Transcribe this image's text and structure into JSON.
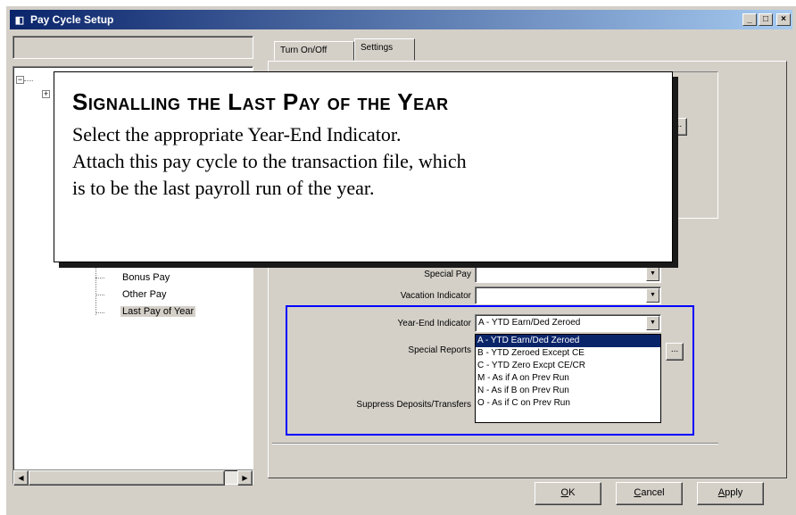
{
  "window": {
    "title": "Pay Cycle Setup",
    "controls": {
      "minimize": "_",
      "maximize": "□",
      "close": "×"
    }
  },
  "tabs": [
    {
      "label": "Turn On/Off"
    },
    {
      "label": "Settings"
    }
  ],
  "tree": {
    "items": [
      {
        "label": "Bonus Pay"
      },
      {
        "label": "Other Pay"
      },
      {
        "label": "Last Pay of Year"
      }
    ]
  },
  "form": {
    "special_pay": {
      "label": "Special Pay",
      "value": ""
    },
    "vacation_indicator": {
      "label": "Vacation Indicator",
      "value": ""
    },
    "year_end_indicator": {
      "label": "Year-End Indicator",
      "value": "A - YTD Earn/Ded Zeroed"
    },
    "special_reports": {
      "label": "Special Reports",
      "button": "..."
    },
    "suppress_deposits": {
      "label": "Suppress Deposits/Transfers"
    },
    "inner_button": "..."
  },
  "dropdown": {
    "options": [
      "A - YTD Earn/Ded Zeroed",
      "B - YTD Zeroed Except CE",
      "C - YTD Zero Excpt CE/CR",
      "M - As if A on Prev Run",
      "N - As if B on Prev Run",
      "O - As if C on Prev Run"
    ],
    "selected_index": 0
  },
  "callout": {
    "title": "Signalling the Last Pay of the Year",
    "lines": [
      "Select the appropriate Year-End Indicator.",
      "Attach this pay cycle to the transaction file, which",
      "is to be the last payroll run of the year."
    ]
  },
  "buttons": {
    "ok": {
      "accel": "O",
      "rest": "K"
    },
    "cancel": {
      "accel": "C",
      "rest": "ancel"
    },
    "apply": {
      "accel": "A",
      "rest": "pply"
    }
  },
  "colors": {
    "titlebar": "#0a246a",
    "highlight_border": "#0000ff",
    "selection": "#0a246a",
    "face": "#d4d0c8"
  }
}
